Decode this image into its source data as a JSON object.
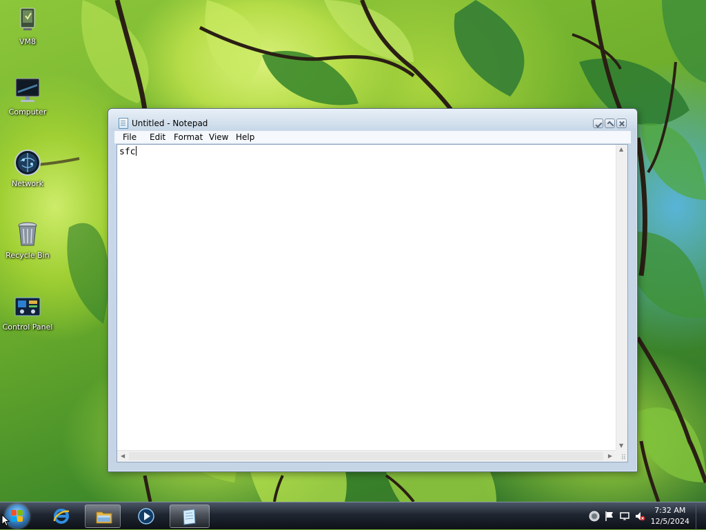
{
  "desktop": {
    "icons": [
      {
        "label": "VM8",
        "icon": "vm8-icon"
      },
      {
        "label": "Computer",
        "icon": "computer-icon"
      },
      {
        "label": "Network",
        "icon": "network-globe-icon"
      },
      {
        "label": "Recycle Bin",
        "icon": "recycle-bin-icon"
      },
      {
        "label": "Control Panel",
        "icon": "control-panel-icon"
      }
    ]
  },
  "notepad": {
    "title": "Untitled - Notepad",
    "menu": [
      "File",
      "Edit",
      "Format",
      "View",
      "Help"
    ],
    "content": "sfc"
  },
  "taskbar": {
    "quick_launch": [
      "internet-explorer-icon",
      "file-explorer-icon",
      "media-player-icon",
      "notepad-icon"
    ],
    "tray_icons": [
      "network-status-icon",
      "action-center-flag-icon",
      "display-icon",
      "volume-muted-icon"
    ],
    "clock": {
      "time": "7:32 AM",
      "date": "12/5/2024"
    }
  }
}
